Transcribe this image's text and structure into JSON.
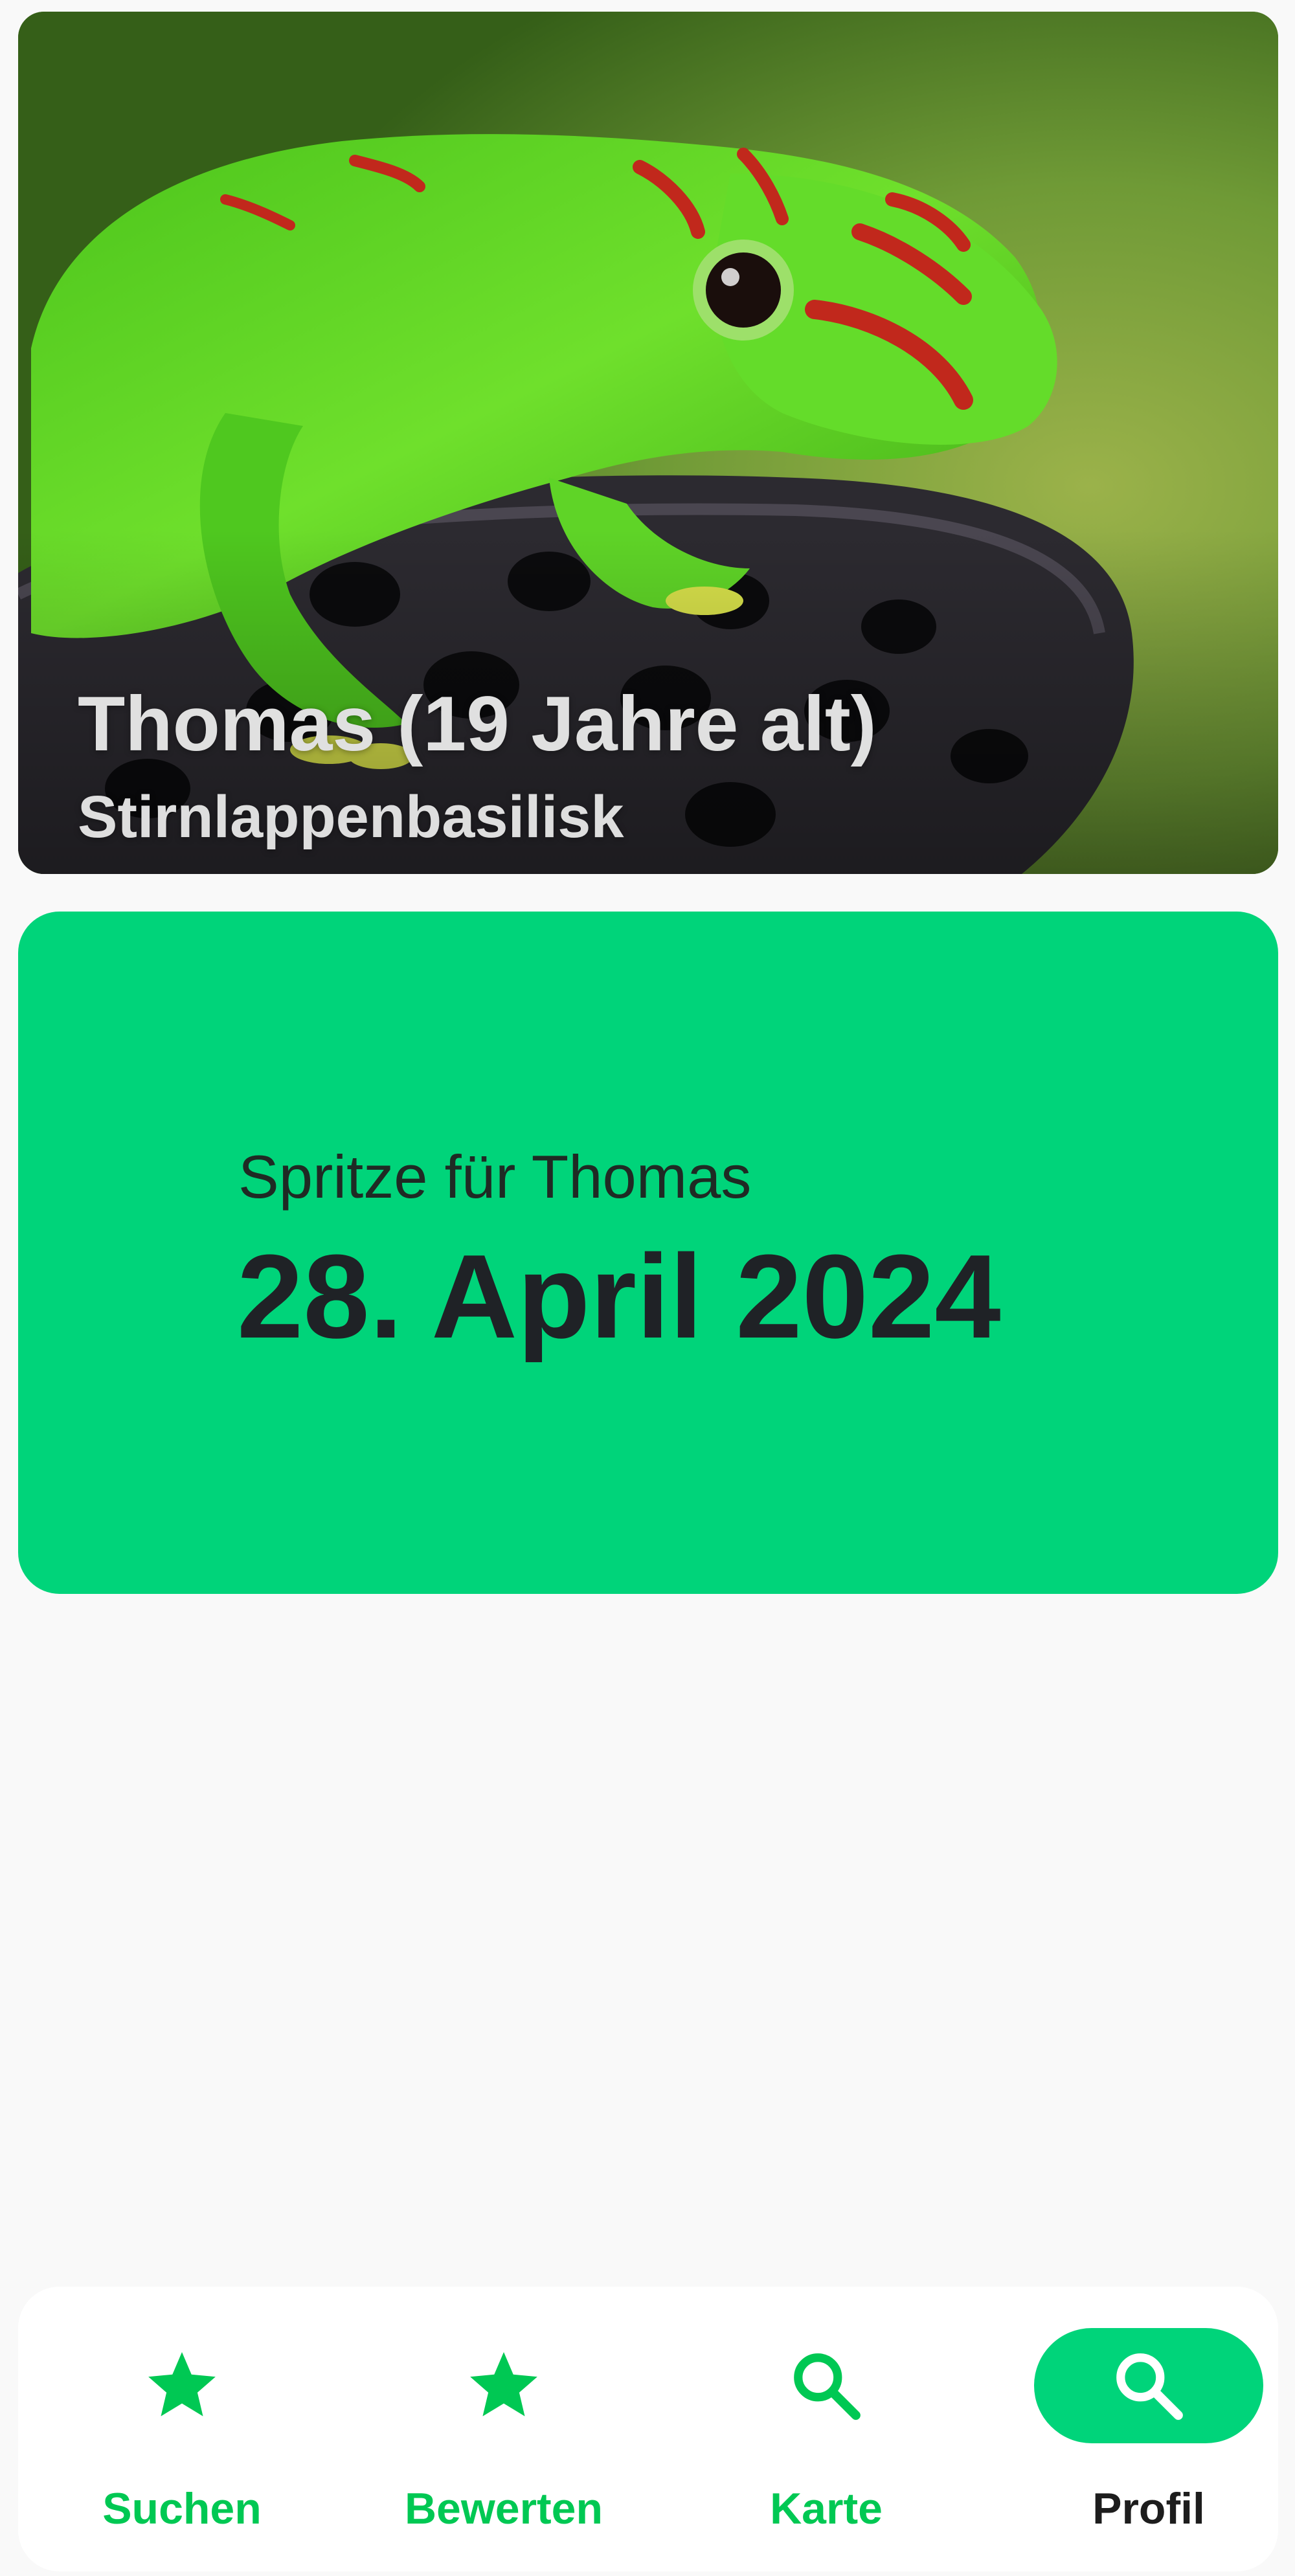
{
  "pet": {
    "name_line": "Thomas (19 Jahre alt)",
    "species": "Stirnlappenbasilisk"
  },
  "reminder": {
    "subtitle": "Spritze für Thomas",
    "date": "28. April 2024",
    "background_color": "#00D47A"
  },
  "bottom_nav": {
    "accent_color": "#00C853",
    "active_index": 3,
    "items": [
      {
        "label": "Suchen",
        "icon": "star-icon"
      },
      {
        "label": "Bewerten",
        "icon": "star-icon"
      },
      {
        "label": "Karte",
        "icon": "search-icon"
      },
      {
        "label": "Profil",
        "icon": "search-icon"
      }
    ]
  }
}
